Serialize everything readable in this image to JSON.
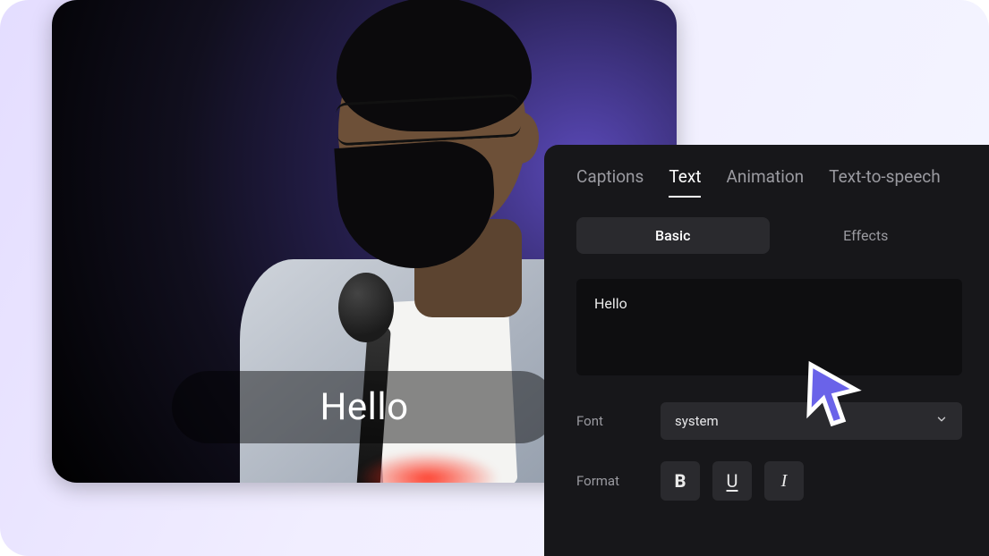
{
  "preview": {
    "caption_text": "Hello"
  },
  "panel": {
    "tabs_primary": {
      "captions": "Captions",
      "text": "Text",
      "animation": "Animation",
      "tts": "Text-to-speech"
    },
    "tabs_secondary": {
      "basic": "Basic",
      "effects": "Effects"
    },
    "text_value": "Hello",
    "font": {
      "label": "Font",
      "selected": "system"
    },
    "format": {
      "label": "Format",
      "bold_glyph": "B",
      "underline_glyph": "U",
      "italic_glyph": "I"
    }
  },
  "colors": {
    "cursor_fill": "#6a63e9",
    "cursor_stroke": "#ffffff"
  }
}
